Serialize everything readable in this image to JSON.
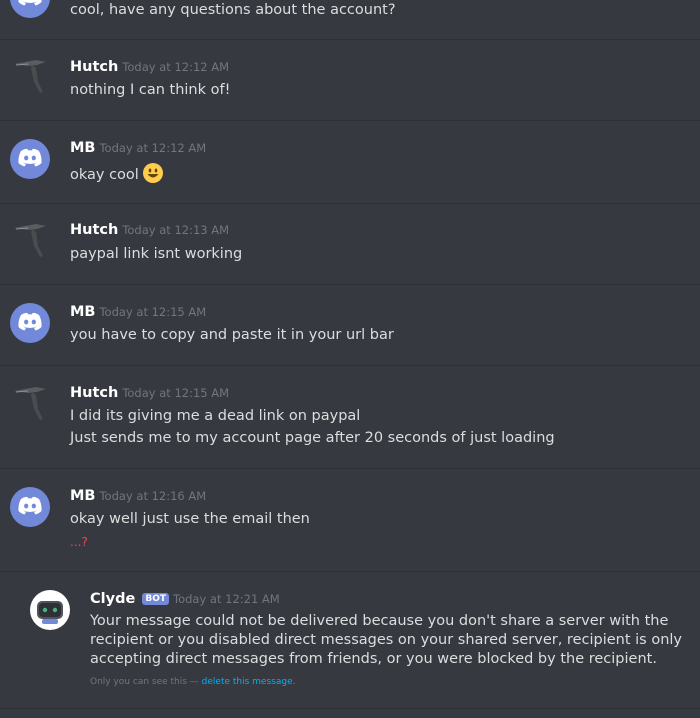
{
  "messages": [
    {
      "text": "cool, have any questions about the account?"
    },
    {
      "author": "Hutch",
      "timestamp": "Today at 12:12 AM",
      "lines": [
        "nothing I can think of!"
      ]
    },
    {
      "author": "MB",
      "timestamp": "Today at 12:12 AM",
      "lines": [
        "okay cool"
      ]
    },
    {
      "author": "Hutch",
      "timestamp": "Today at 12:13 AM",
      "lines": [
        "paypal link isnt working"
      ]
    },
    {
      "author": "MB",
      "timestamp": "Today at 12:15 AM",
      "lines": [
        "you have to copy and paste it in your url bar"
      ]
    },
    {
      "author": "Hutch",
      "timestamp": "Today at 12:15 AM",
      "lines": [
        "I did  its giving me a dead link on paypal",
        "Just sends me to my account page after 20 seconds of just loading"
      ]
    },
    {
      "author": "MB",
      "timestamp": "Today at 12:16 AM",
      "lines": [
        "okay well just use the email then",
        "...?"
      ]
    }
  ],
  "clyde": {
    "name": "Clyde",
    "tag": "BOT",
    "timestamp": "Today at 12:21 AM",
    "text": "Your message could not be delivered because you don't share a server with the recipient or you disabled direct messages on your shared server, recipient is only accepting direct messages from friends, or you were blocked by the recipient.",
    "ephemeral_prefix": "Only you can see this — ",
    "ephemeral_link": "delete this message."
  },
  "colors": {
    "background": "#36393f",
    "blurple": "#7289da",
    "link": "#00b0f4",
    "error": "#f04747"
  }
}
